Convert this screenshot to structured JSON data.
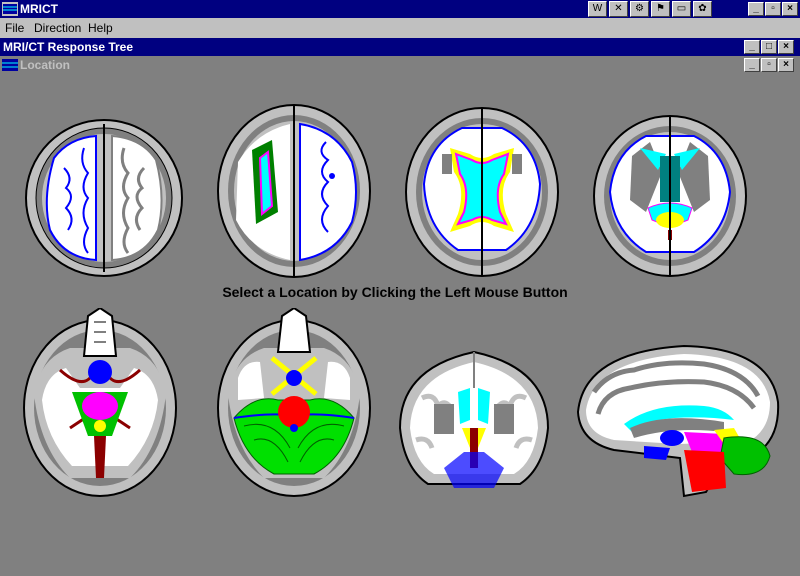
{
  "app": {
    "title": "MRICT"
  },
  "menu": {
    "file": "File",
    "direction": "Direction",
    "help": "Help"
  },
  "window": {
    "response_tree_title": "MRI/CT Response Tree",
    "location_title": "Location",
    "minimize": "_",
    "maximize": "□",
    "restore": "▫",
    "close": "×"
  },
  "main": {
    "prompt": "Select a Location by Clicking the Left Mouse Button"
  },
  "colors": {
    "titlebar": "#000080",
    "inactive_title": "#808080",
    "canvas": "#808080",
    "white_matter": "#ffffff",
    "gray_matter": "#c0c0c0",
    "outline": "#0000ff",
    "cyan": "#00ffff",
    "magenta": "#ff00ff",
    "yellow": "#ffff00",
    "green": "#00c000",
    "red": "#ff0000",
    "dark_red": "#8b0000",
    "blue": "#0000ff"
  },
  "scans": [
    {
      "name": "axial-vertex"
    },
    {
      "name": "axial-centrum"
    },
    {
      "name": "axial-ventricles"
    },
    {
      "name": "axial-basal-ganglia"
    },
    {
      "name": "axial-midbrain"
    },
    {
      "name": "axial-pons"
    },
    {
      "name": "coronal"
    },
    {
      "name": "sagittal"
    }
  ]
}
